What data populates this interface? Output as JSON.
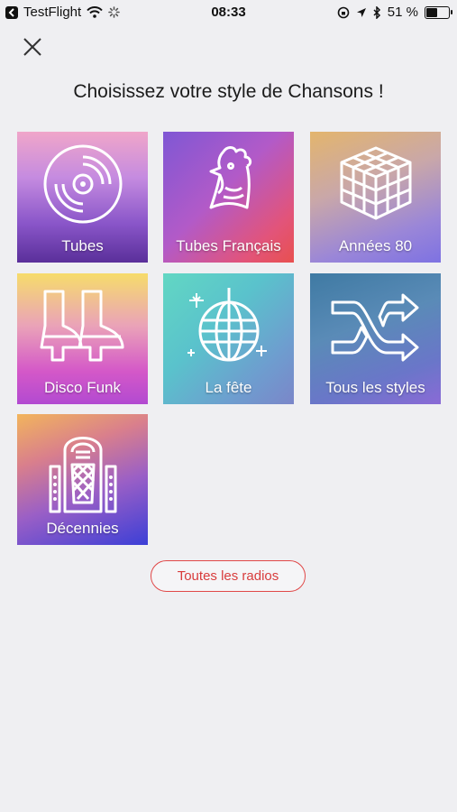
{
  "status_bar": {
    "app": "TestFlight",
    "time": "08:33",
    "battery": "51 %"
  },
  "header": {
    "title": "Choisissez votre style de Chansons !"
  },
  "styles": [
    {
      "label": "Tubes",
      "icon": "vinyl-record-icon"
    },
    {
      "label": "Tubes Français",
      "icon": "rooster-icon"
    },
    {
      "label": "Années 80",
      "icon": "rubiks-cube-icon"
    },
    {
      "label": "Disco Funk",
      "icon": "platform-boots-icon"
    },
    {
      "label": "La fête",
      "icon": "disco-ball-icon"
    },
    {
      "label": "Tous les styles",
      "icon": "shuffle-icon"
    },
    {
      "label": "Décennies",
      "icon": "jukebox-icon"
    }
  ],
  "footer": {
    "all_radios_label": "Toutes les radios"
  },
  "colors": {
    "accent": "#d83c3c",
    "background": "#efeff2"
  }
}
